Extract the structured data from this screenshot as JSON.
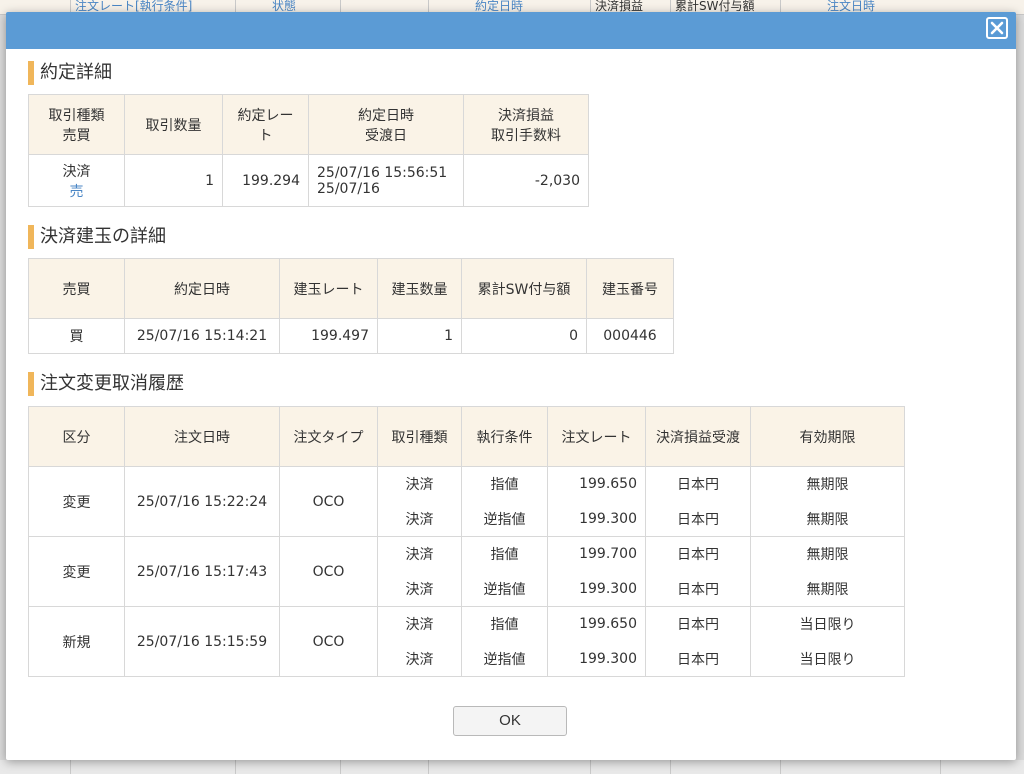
{
  "background": {
    "header_cells": [
      "注文レート[執行条件]",
      "状態",
      "",
      "約定日時",
      "決済損益",
      "累計SW付与額",
      "注文日時"
    ]
  },
  "modal": {
    "close_label": "×"
  },
  "sections": {
    "fill_detail_title": "約定詳細",
    "position_detail_title": "決済建玉の詳細",
    "history_title": "注文変更取消履歴"
  },
  "fill_detail": {
    "headers": {
      "type_side_1": "取引種類",
      "type_side_2": "売買",
      "qty": "取引数量",
      "rate": "約定レート",
      "datetime_1": "約定日時",
      "datetime_2": "受渡日",
      "pnl_1": "決済損益",
      "pnl_2": "取引手数料"
    },
    "row": {
      "type": "決済",
      "side": "売",
      "qty": "1",
      "rate": "199.294",
      "fill_datetime": "25/07/16 15:56:51",
      "settle_date": "25/07/16",
      "pnl": "-2,030"
    }
  },
  "position_detail": {
    "headers": {
      "side": "売買",
      "datetime": "約定日時",
      "rate": "建玉レート",
      "qty": "建玉数量",
      "swap": "累計SW付与額",
      "id": "建玉番号"
    },
    "row": {
      "side": "買",
      "datetime": "25/07/16 15:14:21",
      "rate": "199.497",
      "qty": "1",
      "swap": "0",
      "id": "000446"
    }
  },
  "history": {
    "headers": {
      "kind": "区分",
      "datetime": "注文日時",
      "order_type": "注文タイプ",
      "trade_type": "取引種類",
      "condition": "執行条件",
      "rate": "注文レート",
      "pnl_currency": "決済損益受渡",
      "expiry": "有効期限"
    },
    "rows": [
      {
        "kind": "変更",
        "datetime": "25/07/16 15:22:24",
        "order_type": "OCO",
        "legs": [
          {
            "trade_type": "決済",
            "condition": "指値",
            "rate": "199.650",
            "currency": "日本円",
            "expiry": "無期限"
          },
          {
            "trade_type": "決済",
            "condition": "逆指値",
            "rate": "199.300",
            "currency": "日本円",
            "expiry": "無期限"
          }
        ]
      },
      {
        "kind": "変更",
        "datetime": "25/07/16 15:17:43",
        "order_type": "OCO",
        "legs": [
          {
            "trade_type": "決済",
            "condition": "指値",
            "rate": "199.700",
            "currency": "日本円",
            "expiry": "無期限"
          },
          {
            "trade_type": "決済",
            "condition": "逆指値",
            "rate": "199.300",
            "currency": "日本円",
            "expiry": "無期限"
          }
        ]
      },
      {
        "kind": "新規",
        "datetime": "25/07/16 15:15:59",
        "order_type": "OCO",
        "legs": [
          {
            "trade_type": "決済",
            "condition": "指値",
            "rate": "199.650",
            "currency": "日本円",
            "expiry": "当日限り"
          },
          {
            "trade_type": "決済",
            "condition": "逆指値",
            "rate": "199.300",
            "currency": "日本円",
            "expiry": "当日限り"
          }
        ]
      }
    ]
  },
  "footer": {
    "ok_label": "OK"
  },
  "colors": {
    "header_bar": "#5b9bd5",
    "accent": "#f0b65a",
    "th_background": "#faf3e7",
    "sell_blue": "#4a86c5",
    "buy_red": "#cc3a2f"
  }
}
